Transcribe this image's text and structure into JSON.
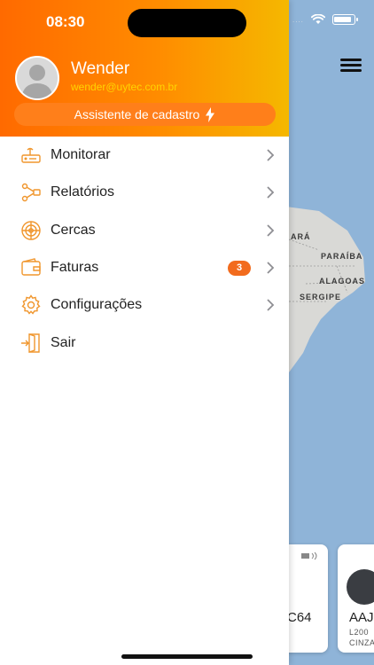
{
  "status_bar": {
    "time": "08:30",
    "dots": "...."
  },
  "user": {
    "name": "Wender",
    "email": "wender@uytec.com.br"
  },
  "wizard_button": {
    "label": "Assistente de cadastro"
  },
  "menu": [
    {
      "label": "Monitorar",
      "icon": "router-icon",
      "chevron": true
    },
    {
      "label": "Relatórios",
      "icon": "report-flow-icon",
      "chevron": true
    },
    {
      "label": "Cercas",
      "icon": "radar-icon",
      "chevron": true
    },
    {
      "label": "Faturas",
      "icon": "wallet-icon",
      "chevron": true,
      "badge": "3"
    },
    {
      "label": "Configurações",
      "icon": "gear-icon",
      "chevron": true
    },
    {
      "label": "Sair",
      "icon": "exit-icon",
      "chevron": false
    }
  ],
  "map": {
    "labels": [
      "ARÁ",
      "PARAÍBA",
      "ALAGOAS",
      "SERGIPE"
    ]
  },
  "vehicles": [
    {
      "plate_fragment": "C64"
    },
    {
      "plate_fragment": "AAJ",
      "model_fragment": "L200",
      "color_fragment": "CINZA"
    }
  ],
  "colors": {
    "accent": "#ff7a00",
    "accent_end": "#f5b800",
    "email": "#ffd400",
    "badge": "#f26b1d",
    "sea": "#8fb4d8"
  }
}
